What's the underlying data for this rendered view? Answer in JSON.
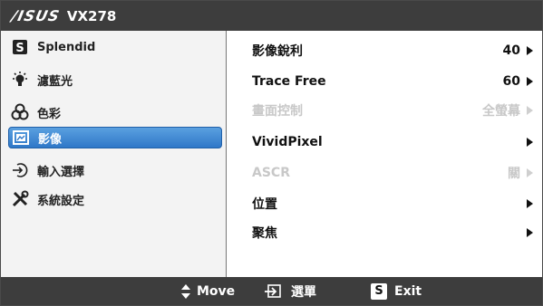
{
  "header": {
    "brand": "/ISUS",
    "model": "VX278"
  },
  "sidebar": {
    "items": [
      {
        "label": "Splendid",
        "icon": "splendid-s-icon",
        "active": false
      },
      {
        "label": "濾藍光",
        "icon": "bulb-icon",
        "active": false
      },
      {
        "label": "色彩",
        "icon": "color-triad-icon",
        "active": false
      },
      {
        "label": "影像",
        "icon": "image-icon",
        "active": true
      },
      {
        "label": "輸入選擇",
        "icon": "input-arrow-icon",
        "active": false
      },
      {
        "label": "系統設定",
        "icon": "tools-icon",
        "active": false
      }
    ]
  },
  "main": {
    "rows": [
      {
        "label": "影像銳利",
        "value": "40",
        "disabled": false
      },
      {
        "label": "Trace Free",
        "value": "60",
        "disabled": false
      },
      {
        "label": "畫面控制",
        "value": "全螢幕",
        "disabled": true
      },
      {
        "label": "VividPixel",
        "value": "",
        "disabled": false
      },
      {
        "label": "ASCR",
        "value": "關",
        "disabled": true
      },
      {
        "label": "位置",
        "value": "",
        "disabled": false
      },
      {
        "label": "聚焦",
        "value": "",
        "disabled": false
      }
    ]
  },
  "footer": {
    "move": "Move",
    "menu": "選單",
    "exit_key": "S",
    "exit": "Exit"
  },
  "colors": {
    "bar": "#3d3d3d",
    "highlight": "#2f78c8",
    "disabled": "#c8c8c8"
  }
}
